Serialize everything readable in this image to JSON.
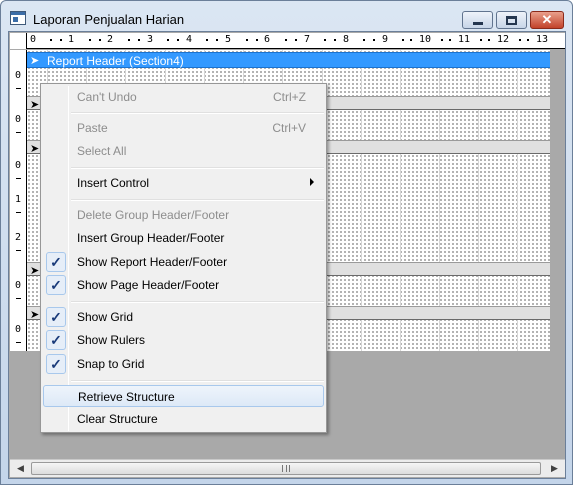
{
  "window": {
    "title": "Laporan Penjualan Harian",
    "close_glyph": "✕"
  },
  "ruler": {
    "top_labels": [
      "0",
      "1",
      "2",
      "3",
      "4",
      "5",
      "6",
      "7",
      "8",
      "9",
      "10",
      "11",
      "12",
      "13"
    ],
    "side_labels": [
      "0",
      "0",
      "0",
      "1",
      "2",
      "0",
      "0"
    ]
  },
  "report": {
    "active_band_label": "Report Header (Section4)",
    "band_icon": "pointer-arrow-icon"
  },
  "scrollbar": {
    "left_arrow": "◀",
    "right_arrow": "▶"
  },
  "context_menu": {
    "items": [
      {
        "label": "Can't Undo",
        "shortcut": "Ctrl+Z",
        "enabled": false,
        "checked": false
      },
      {
        "label": "Paste",
        "shortcut": "Ctrl+V",
        "enabled": false,
        "checked": false
      },
      {
        "label": "Select All",
        "shortcut": "",
        "enabled": false,
        "checked": false
      },
      {
        "label": "Insert Control",
        "shortcut": "",
        "enabled": true,
        "checked": false,
        "submenu": true
      },
      {
        "label": "Delete Group Header/Footer",
        "shortcut": "",
        "enabled": false,
        "checked": false
      },
      {
        "label": "Insert Group Header/Footer",
        "shortcut": "",
        "enabled": true,
        "checked": false
      },
      {
        "label": "Show Report Header/Footer",
        "shortcut": "",
        "enabled": true,
        "checked": true
      },
      {
        "label": "Show Page Header/Footer",
        "shortcut": "",
        "enabled": true,
        "checked": true
      },
      {
        "label": "Show Grid",
        "shortcut": "",
        "enabled": true,
        "checked": true
      },
      {
        "label": "Show Rulers",
        "shortcut": "",
        "enabled": true,
        "checked": true
      },
      {
        "label": "Snap to Grid",
        "shortcut": "",
        "enabled": true,
        "checked": true
      },
      {
        "label": "Retrieve Structure",
        "shortcut": "",
        "enabled": true,
        "checked": false,
        "highlighted": true
      },
      {
        "label": "Clear Structure",
        "shortcut": "",
        "enabled": true,
        "checked": false
      }
    ],
    "check_glyph": "✓"
  },
  "colors": {
    "active_band": "#3399ff",
    "menu_background": "#f0f0f0",
    "disabled_text": "#8d8d8d"
  }
}
